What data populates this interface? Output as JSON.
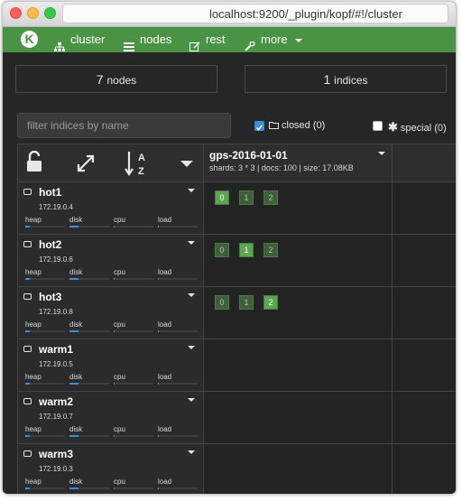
{
  "browser": {
    "url": "localhost:9200/_plugin/kopf/#!/cluster"
  },
  "navbar": {
    "logo": "K",
    "items": [
      {
        "label": "cluster",
        "icon": "sitemap-icon"
      },
      {
        "label": "nodes",
        "icon": "list-icon"
      },
      {
        "label": "rest",
        "icon": "edit-icon"
      },
      {
        "label": "more",
        "icon": "wrench-icon"
      }
    ]
  },
  "stats": {
    "nodes_count": "7",
    "nodes_label": "nodes",
    "indices_count": "1",
    "indices_label": "indices"
  },
  "filters": {
    "placeholder": "filter indices by name",
    "closed": {
      "label": "closed (0)",
      "checked": true
    },
    "special": {
      "label": "special (0)",
      "checked": false
    }
  },
  "header": {
    "icons": [
      "unlock-icon",
      "expand-icon",
      "sort-alpha-icon",
      "caret-down-icon"
    ],
    "sort_text": "A Z",
    "index": {
      "name": "gps-2016-01-01",
      "info": "shards: 3 * 3 | docs: 100 | size: 17.08KB"
    }
  },
  "metric_labels": [
    "heap",
    "disk",
    "cpu",
    "load"
  ],
  "nodes": [
    {
      "name": "hot1",
      "ip": "172.19.0.4",
      "heap": 0.12,
      "disk": 0.22,
      "cpu": 0.02,
      "load": 0.02,
      "shards": [
        "0",
        "1",
        "2"
      ],
      "primary": 0
    },
    {
      "name": "hot2",
      "ip": "172.19.0.6",
      "heap": 0.12,
      "disk": 0.22,
      "cpu": 0.02,
      "load": 0.02,
      "shards": [
        "0",
        "1",
        "2"
      ],
      "primary": 1
    },
    {
      "name": "hot3",
      "ip": "172.19.0.8",
      "heap": 0.12,
      "disk": 0.22,
      "cpu": 0.02,
      "load": 0.02,
      "shards": [
        "0",
        "1",
        "2"
      ],
      "primary": 2
    },
    {
      "name": "warm1",
      "ip": "172.19.0.5",
      "heap": 0.12,
      "disk": 0.22,
      "cpu": 0.02,
      "load": 0.02,
      "shards": [],
      "primary": -1
    },
    {
      "name": "warm2",
      "ip": "172.19.0.7",
      "heap": 0.12,
      "disk": 0.22,
      "cpu": 0.02,
      "load": 0.02,
      "shards": [],
      "primary": -1
    },
    {
      "name": "warm3",
      "ip": "172.19.0.3",
      "heap": 0.12,
      "disk": 0.22,
      "cpu": 0.02,
      "load": 0.02,
      "shards": [],
      "primary": -1
    }
  ],
  "colors": {
    "navbar": "#4a9244",
    "bar_fill": "#3a8fdc",
    "primary_shard": "#5ea552",
    "replica_shard": "#3f5f3a"
  }
}
